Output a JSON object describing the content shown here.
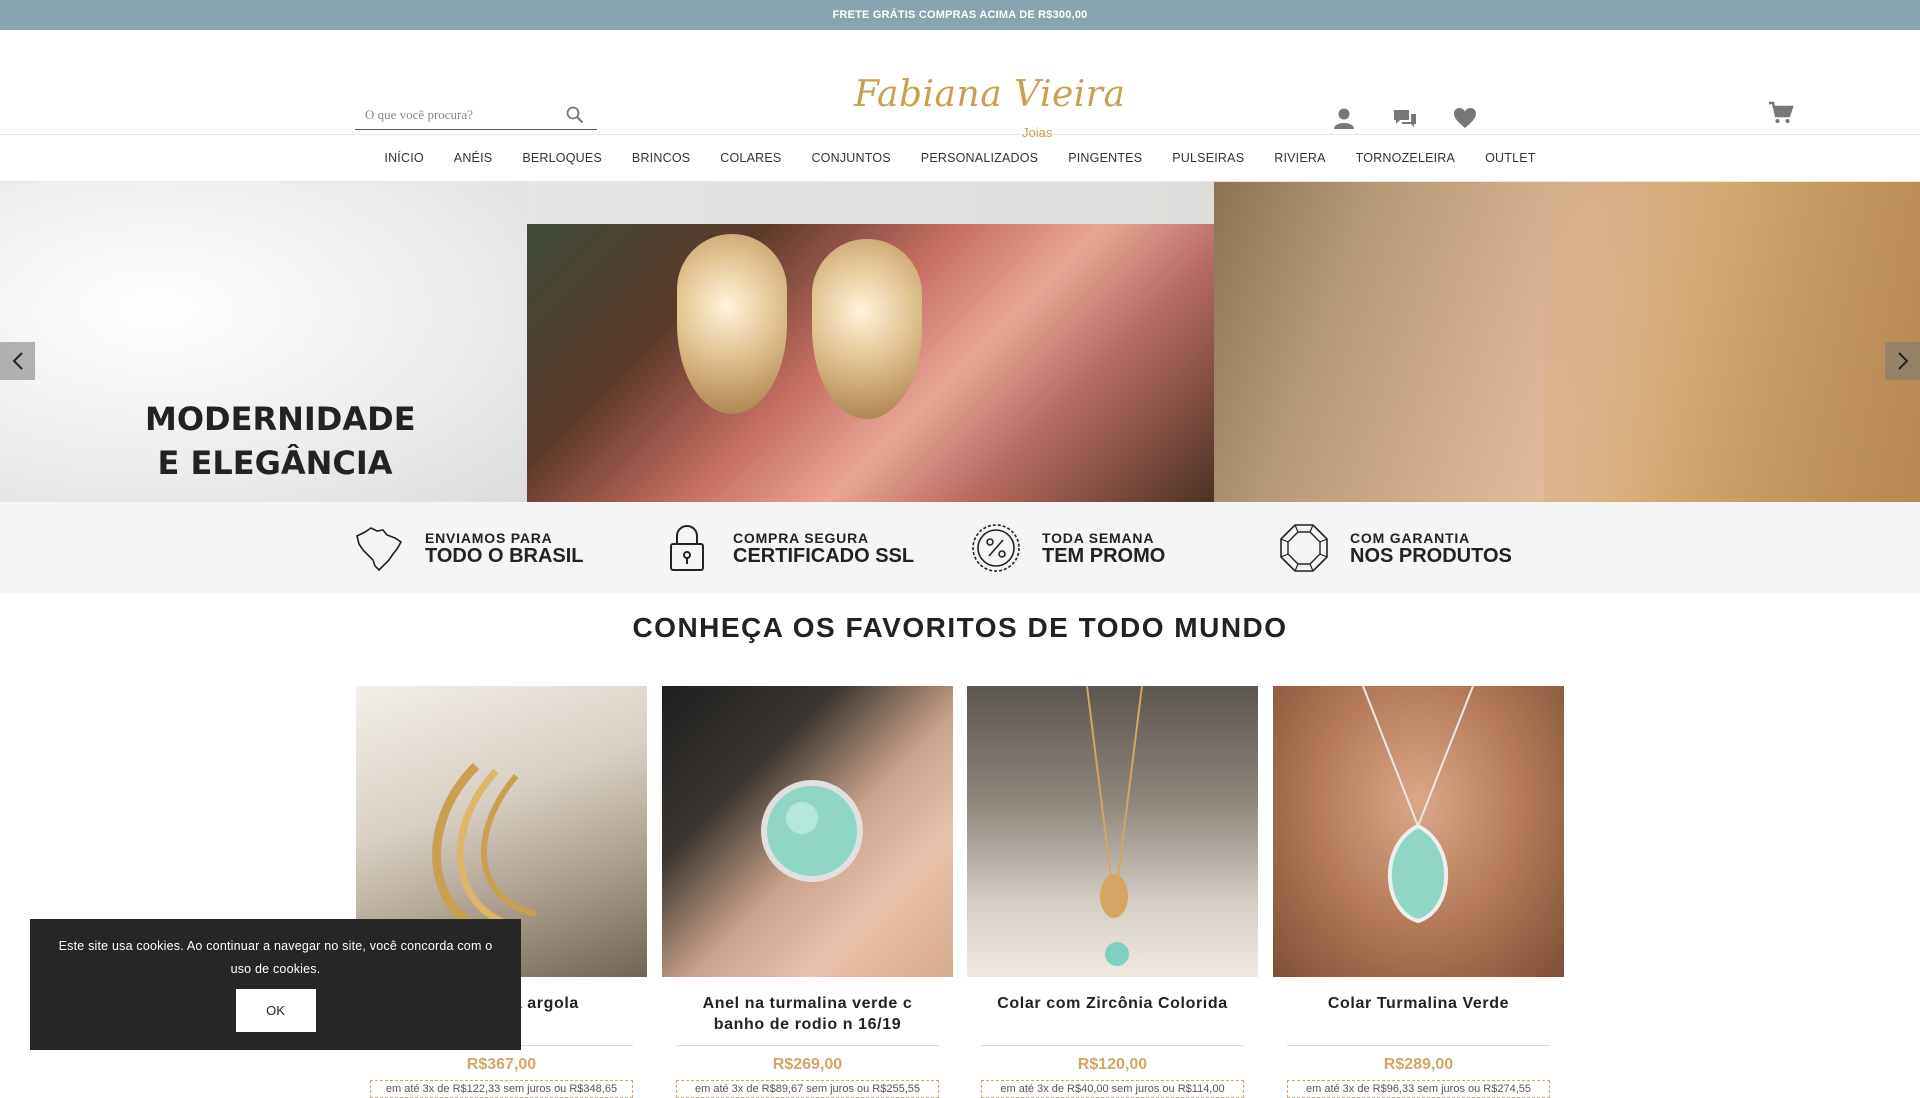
{
  "topbar": {
    "text": "FRETE GRÁTIS COMPRAS ACIMA DE R$300,00"
  },
  "header": {
    "search_placeholder": "O que você procura?",
    "logo_text": "Fabiana Vieira",
    "logo_sub": "Joias",
    "icons": [
      "user-icon",
      "chat-icon",
      "heart-icon",
      "cart-icon"
    ]
  },
  "nav": {
    "items": [
      "INÍCIO",
      "ANÉIS",
      "BERLOQUES",
      "BRINCOS",
      "COLARES",
      "CONJUNTOS",
      "PERSONALIZADOS",
      "PINGENTES",
      "PULSEIRAS",
      "RIVIERA",
      "TORNOZELEIRA",
      "OUTLET"
    ]
  },
  "hero": {
    "headline_line1": "MODERNIDADE",
    "headline_line2": "E ELEGÂNCIA",
    "prev_icon": "chevron-left-icon",
    "next_icon": "chevron-right-icon"
  },
  "benefits": [
    {
      "icon": "brazil-map-icon",
      "small": "ENVIAMOS PARA",
      "big": "TODO O BRASIL"
    },
    {
      "icon": "lock-icon",
      "small": "COMPRA SEGURA",
      "big": "CERTIFICADO SSL"
    },
    {
      "icon": "percent-badge-icon",
      "small": "TODA SEMANA",
      "big": "TEM PROMO"
    },
    {
      "icon": "diamond-icon",
      "small": "COM GARANTIA",
      "big": "NOS PRODUTOS"
    }
  ],
  "section": {
    "title": "CONHEÇA OS FAVORITOS DE TODO MUNDO"
  },
  "products": [
    {
      "name": "Brinco meia argola",
      "price": "R$367,00",
      "installments": "em até 3x de R$122,33 sem juros ou R$348,65"
    },
    {
      "name": "Anel na turmalina verde c banho de rodio n 16/19",
      "price": "R$269,00",
      "installments": "em até 3x de R$89,67 sem juros ou R$255,55"
    },
    {
      "name": "Colar com Zircônia Colorida",
      "price": "R$120,00",
      "installments": "em até 3x de R$40,00 sem juros ou R$114,00"
    },
    {
      "name": "Colar Turmalina Verde",
      "price": "R$289,00",
      "installments": "em até 3x de R$96,33 sem juros ou R$274,55"
    }
  ],
  "cookie": {
    "text": "Este site usa cookies. Ao continuar a navegar no site, você concorda com o uso de cookies.",
    "button": "OK"
  },
  "colors": {
    "topbar": "#88a4ae",
    "gold": "#c9a04f",
    "price": "#d4a563"
  }
}
